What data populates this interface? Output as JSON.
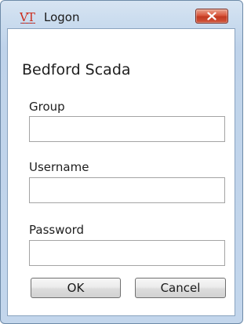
{
  "window": {
    "title": "Logon",
    "icon": "vt-logo-icon",
    "accent_color": "#cc2a1a"
  },
  "form": {
    "app_name": "Bedford Scada",
    "group": {
      "label": "Group",
      "value": ""
    },
    "username": {
      "label": "Username",
      "value": ""
    },
    "password": {
      "label": "Password",
      "value": ""
    }
  },
  "buttons": {
    "ok_label": "OK",
    "cancel_label": "Cancel",
    "close_icon": "close-icon"
  }
}
